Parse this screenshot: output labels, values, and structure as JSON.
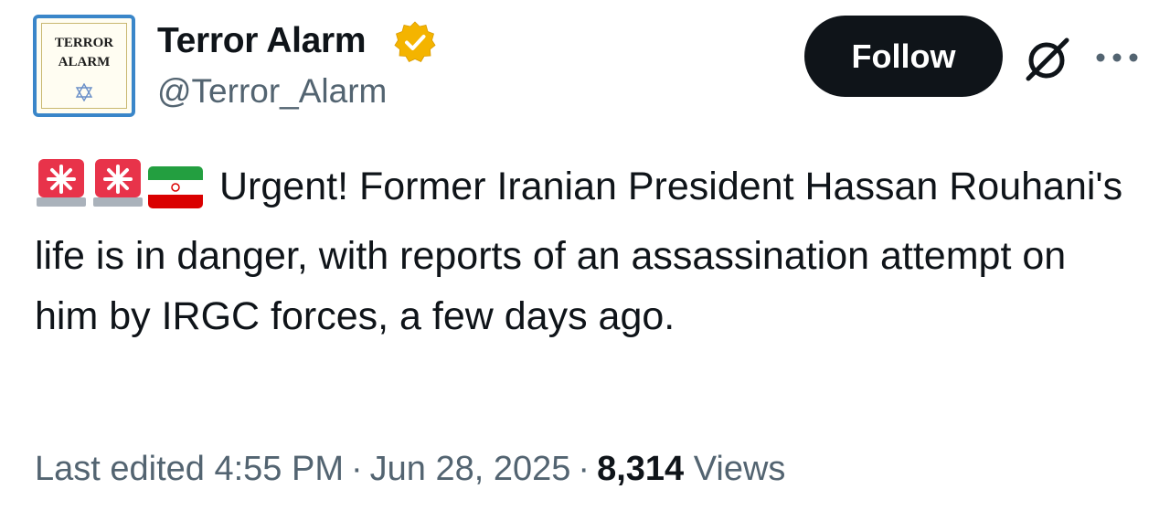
{
  "avatar": {
    "logo_line1": "TERROR",
    "logo_line2": "ALARM"
  },
  "author": {
    "display_name": "Terror Alarm",
    "handle": "@Terror_Alarm",
    "verified_icon": "verified-badge-icon",
    "verified_color": "#f4b400"
  },
  "actions": {
    "follow_label": "Follow",
    "grok_icon": "grok-icon",
    "more_icon": "more-icon"
  },
  "tweet": {
    "emojis": [
      "police-light-emoji",
      "police-light-emoji",
      "iran-flag-emoji"
    ],
    "text": "Urgent! Former Iranian President Hassan Rouhani's life is in danger, with reports of an assassination attempt on him by IRGC forces, a few days ago."
  },
  "meta": {
    "edited_prefix": "Last edited",
    "time": "4:55 PM",
    "separator": "·",
    "date": "Jun 28, 2025",
    "views_count": "8,314",
    "views_label": "Views"
  }
}
